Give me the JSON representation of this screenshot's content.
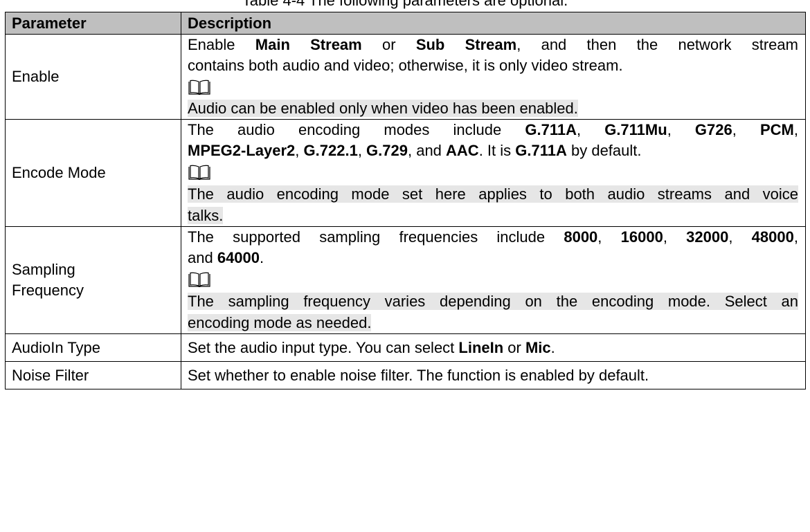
{
  "caption": "Table 4-4 The following parameters are optional.",
  "table": {
    "headers": {
      "parameter": "Parameter",
      "description": "Description"
    },
    "rows": [
      {
        "parameter": "Enable",
        "lines": [
          [
            {
              "t": "Enable "
            },
            {
              "t": "Main Stream",
              "b": true
            },
            {
              "t": " or "
            },
            {
              "t": "Sub Stream",
              "b": true
            },
            {
              "t": ", and then the network stream"
            }
          ],
          [
            {
              "t": "contains both audio and video; otherwise, it is only video stream."
            }
          ]
        ],
        "note": [
          "Audio can be enabled only when video has been enabled."
        ]
      },
      {
        "parameter": "Encode Mode",
        "lines": [
          [
            {
              "t": "The audio encoding modes include "
            },
            {
              "t": "G.711A",
              "b": true
            },
            {
              "t": ", "
            },
            {
              "t": "G.711Mu",
              "b": true
            },
            {
              "t": ", "
            },
            {
              "t": "G726",
              "b": true
            },
            {
              "t": ", "
            },
            {
              "t": "PCM",
              "b": true
            },
            {
              "t": ","
            }
          ],
          [
            {
              "t": "MPEG2-Layer2",
              "b": true
            },
            {
              "t": ", "
            },
            {
              "t": "G.722.1",
              "b": true
            },
            {
              "t": ", "
            },
            {
              "t": "G.729",
              "b": true
            },
            {
              "t": ", and "
            },
            {
              "t": "AAC",
              "b": true
            },
            {
              "t": ". It is "
            },
            {
              "t": "G.711A",
              "b": true
            },
            {
              "t": " by default."
            }
          ]
        ],
        "note": [
          "The audio encoding mode set here applies to both audio streams and voice",
          "talks."
        ]
      },
      {
        "parameter_lines": [
          "Sampling",
          "Frequency"
        ],
        "lines": [
          [
            {
              "t": "The supported sampling frequencies include "
            },
            {
              "t": "8000",
              "b": true
            },
            {
              "t": ", "
            },
            {
              "t": "16000",
              "b": true
            },
            {
              "t": ", "
            },
            {
              "t": "32000",
              "b": true
            },
            {
              "t": ", "
            },
            {
              "t": "48000",
              "b": true
            },
            {
              "t": ","
            }
          ],
          [
            {
              "t": "and "
            },
            {
              "t": "64000",
              "b": true
            },
            {
              "t": "."
            }
          ]
        ],
        "note": [
          "The sampling frequency varies depending on the encoding mode. Select an",
          "encoding mode as needed."
        ]
      },
      {
        "parameter": "AudioIn Type",
        "lines": [
          [
            {
              "t": "Set the audio input type. You can select "
            },
            {
              "t": "LineIn",
              "b": true
            },
            {
              "t": " or "
            },
            {
              "t": "Mic",
              "b": true
            },
            {
              "t": "."
            }
          ]
        ]
      },
      {
        "parameter": "Noise Filter",
        "lines": [
          [
            {
              "t": "Set whether to enable noise filter. The function is enabled by default."
            }
          ]
        ]
      }
    ]
  },
  "icons": {
    "note": "book-icon"
  }
}
